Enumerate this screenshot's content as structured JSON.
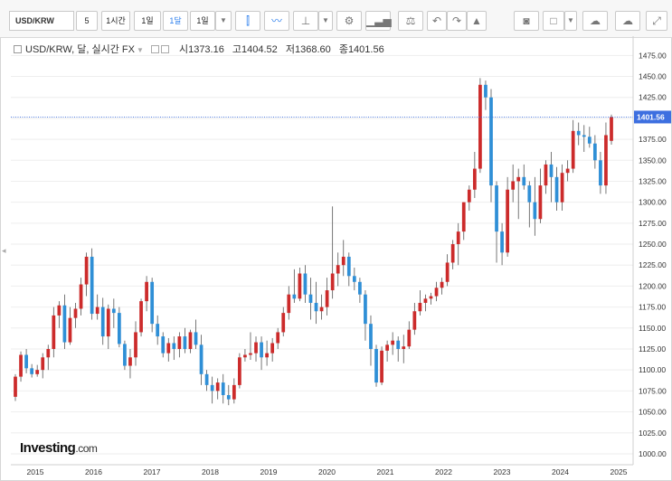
{
  "toolbar": {
    "symbol": "USD/KRW",
    "intervals": [
      "5",
      "1시간",
      "1일",
      "1달",
      "1일"
    ],
    "active_interval": "1달",
    "icons": [
      "dropdown-icon",
      "candlestick-icon",
      "line-chart-icon",
      "bar-type-icon",
      "dropdown-icon",
      "settings-gear-icon",
      "indicators-icon",
      "balance-scale-icon",
      "undo-icon",
      "redo-icon",
      "alert-bell-icon",
      "camera-icon",
      "color-square-icon",
      "dropdown-icon",
      "cloud-download-icon",
      "cloud-upload-icon",
      "fullscreen-icon"
    ]
  },
  "legend": {
    "title": "USD/KRW, 달, 실시간 FX",
    "open_label": "시",
    "open": "1373.16",
    "high_label": "고",
    "high": "1404.52",
    "low_label": "저",
    "low": "1368.60",
    "close_label": "종",
    "close": "1401.56"
  },
  "brand": {
    "name": "Investing",
    "suffix": ".com"
  },
  "colors": {
    "up": "#cc2b2b",
    "down": "#2f8fd6",
    "price_label_bg": "#3d6fe0",
    "price_line": "#3d6fe0"
  },
  "chart_data": {
    "type": "candlestick",
    "interval": "monthly",
    "title": "USD/KRW",
    "price_label": "1401.56",
    "y_axis": {
      "side": "right",
      "ylim": [
        987,
        1498
      ],
      "ticks": [
        1000,
        1025,
        1050,
        1075,
        1100,
        1125,
        1150,
        1175,
        1200,
        1225,
        1250,
        1275,
        1300,
        1325,
        1350,
        1375,
        1400,
        1425,
        1450,
        1475
      ]
    },
    "x_axis": {
      "labels": [
        "2015",
        "2016",
        "2017",
        "2018",
        "2019",
        "2020",
        "2021",
        "2022",
        "2023",
        "2024",
        "2025"
      ]
    },
    "ohlc": [
      [
        1068,
        1095,
        1063,
        1092
      ],
      [
        1092,
        1122,
        1086,
        1118
      ],
      [
        1118,
        1125,
        1096,
        1102
      ],
      [
        1102,
        1107,
        1091,
        1095
      ],
      [
        1095,
        1106,
        1092,
        1100
      ],
      [
        1100,
        1120,
        1090,
        1115
      ],
      [
        1115,
        1130,
        1100,
        1125
      ],
      [
        1125,
        1175,
        1115,
        1165
      ],
      [
        1165,
        1182,
        1150,
        1177
      ],
      [
        1177,
        1190,
        1125,
        1133
      ],
      [
        1133,
        1175,
        1130,
        1162
      ],
      [
        1162,
        1180,
        1150,
        1173
      ],
      [
        1173,
        1210,
        1165,
        1202
      ],
      [
        1202,
        1240,
        1188,
        1235
      ],
      [
        1235,
        1245,
        1160,
        1167
      ],
      [
        1167,
        1190,
        1160,
        1175
      ],
      [
        1175,
        1186,
        1130,
        1140
      ],
      [
        1140,
        1178,
        1125,
        1173
      ],
      [
        1173,
        1185,
        1150,
        1168
      ],
      [
        1168,
        1175,
        1127,
        1131
      ],
      [
        1131,
        1135,
        1100,
        1105
      ],
      [
        1105,
        1125,
        1090,
        1115
      ],
      [
        1115,
        1158,
        1105,
        1145
      ],
      [
        1145,
        1185,
        1140,
        1182
      ],
      [
        1182,
        1212,
        1170,
        1205
      ],
      [
        1205,
        1210,
        1145,
        1155
      ],
      [
        1155,
        1165,
        1130,
        1140
      ],
      [
        1140,
        1145,
        1115,
        1120
      ],
      [
        1120,
        1138,
        1110,
        1132
      ],
      [
        1132,
        1140,
        1112,
        1125
      ],
      [
        1125,
        1145,
        1115,
        1140
      ],
      [
        1140,
        1150,
        1120,
        1125
      ],
      [
        1125,
        1148,
        1120,
        1145
      ],
      [
        1145,
        1160,
        1125,
        1130
      ],
      [
        1130,
        1142,
        1082,
        1095
      ],
      [
        1095,
        1100,
        1075,
        1082
      ],
      [
        1082,
        1092,
        1060,
        1075
      ],
      [
        1075,
        1090,
        1065,
        1085
      ],
      [
        1085,
        1095,
        1060,
        1070
      ],
      [
        1070,
        1082,
        1058,
        1065
      ],
      [
        1065,
        1090,
        1060,
        1082
      ],
      [
        1082,
        1120,
        1078,
        1115
      ],
      [
        1115,
        1125,
        1110,
        1118
      ],
      [
        1118,
        1145,
        1112,
        1120
      ],
      [
        1120,
        1140,
        1110,
        1133
      ],
      [
        1133,
        1140,
        1100,
        1115
      ],
      [
        1115,
        1135,
        1105,
        1120
      ],
      [
        1120,
        1138,
        1110,
        1132
      ],
      [
        1132,
        1150,
        1125,
        1145
      ],
      [
        1145,
        1175,
        1140,
        1168
      ],
      [
        1168,
        1200,
        1160,
        1190
      ],
      [
        1190,
        1220,
        1180,
        1185
      ],
      [
        1185,
        1222,
        1182,
        1215
      ],
      [
        1215,
        1225,
        1180,
        1190
      ],
      [
        1190,
        1210,
        1160,
        1180
      ],
      [
        1180,
        1205,
        1155,
        1170
      ],
      [
        1170,
        1190,
        1160,
        1175
      ],
      [
        1175,
        1210,
        1165,
        1195
      ],
      [
        1195,
        1295,
        1185,
        1215
      ],
      [
        1215,
        1240,
        1200,
        1225
      ],
      [
        1225,
        1255,
        1212,
        1235
      ],
      [
        1235,
        1240,
        1200,
        1212
      ],
      [
        1212,
        1222,
        1195,
        1205
      ],
      [
        1205,
        1210,
        1180,
        1190
      ],
      [
        1190,
        1195,
        1135,
        1155
      ],
      [
        1155,
        1165,
        1105,
        1125
      ],
      [
        1125,
        1130,
        1080,
        1085
      ],
      [
        1085,
        1128,
        1082,
        1123
      ],
      [
        1123,
        1135,
        1110,
        1130
      ],
      [
        1130,
        1145,
        1118,
        1135
      ],
      [
        1135,
        1140,
        1110,
        1125
      ],
      [
        1125,
        1142,
        1108,
        1128
      ],
      [
        1128,
        1158,
        1125,
        1148
      ],
      [
        1148,
        1180,
        1142,
        1170
      ],
      [
        1170,
        1195,
        1165,
        1180
      ],
      [
        1180,
        1190,
        1170,
        1185
      ],
      [
        1185,
        1192,
        1178,
        1188
      ],
      [
        1188,
        1205,
        1182,
        1198
      ],
      [
        1198,
        1210,
        1190,
        1205
      ],
      [
        1205,
        1238,
        1200,
        1228
      ],
      [
        1228,
        1255,
        1220,
        1250
      ],
      [
        1250,
        1275,
        1225,
        1265
      ],
      [
        1265,
        1300,
        1255,
        1300
      ],
      [
        1300,
        1320,
        1290,
        1315
      ],
      [
        1315,
        1360,
        1305,
        1340
      ],
      [
        1340,
        1448,
        1335,
        1440
      ],
      [
        1440,
        1445,
        1410,
        1425
      ],
      [
        1425,
        1435,
        1300,
        1320
      ],
      [
        1320,
        1325,
        1228,
        1265
      ],
      [
        1265,
        1275,
        1225,
        1240
      ],
      [
        1240,
        1330,
        1235,
        1315
      ],
      [
        1315,
        1345,
        1300,
        1325
      ],
      [
        1325,
        1340,
        1280,
        1330
      ],
      [
        1330,
        1345,
        1315,
        1320
      ],
      [
        1320,
        1325,
        1270,
        1300
      ],
      [
        1300,
        1330,
        1260,
        1280
      ],
      [
        1280,
        1340,
        1275,
        1320
      ],
      [
        1320,
        1350,
        1310,
        1345
      ],
      [
        1345,
        1360,
        1300,
        1330
      ],
      [
        1330,
        1342,
        1290,
        1300
      ],
      [
        1300,
        1345,
        1290,
        1335
      ],
      [
        1335,
        1350,
        1325,
        1340
      ],
      [
        1340,
        1398,
        1335,
        1385
      ],
      [
        1385,
        1395,
        1368,
        1380
      ],
      [
        1380,
        1392,
        1360,
        1378
      ],
      [
        1378,
        1390,
        1365,
        1370
      ],
      [
        1370,
        1380,
        1340,
        1350
      ],
      [
        1350,
        1360,
        1310,
        1320
      ],
      [
        1320,
        1395,
        1310,
        1380
      ],
      [
        1373.16,
        1404.52,
        1368.6,
        1401.56
      ]
    ]
  }
}
